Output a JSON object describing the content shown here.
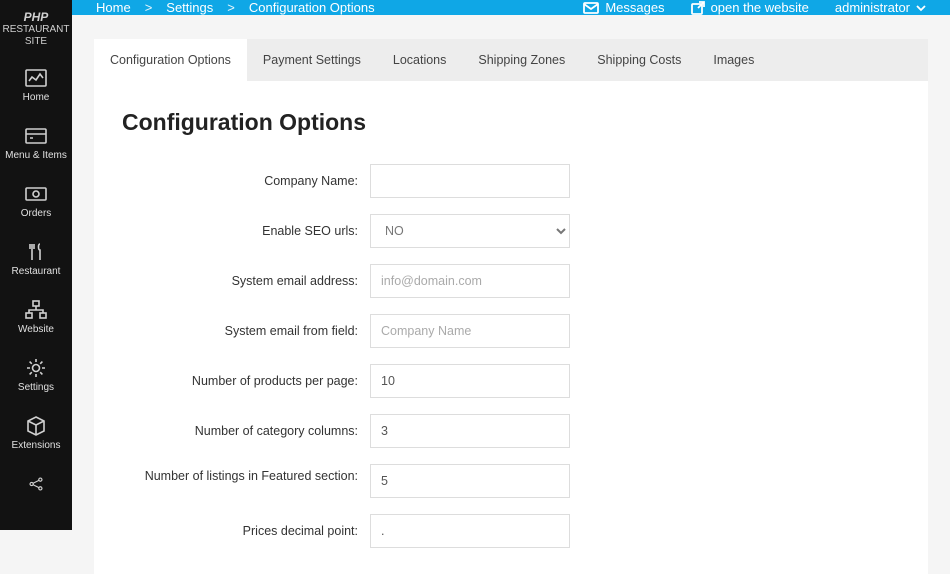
{
  "brand": {
    "line1": "PHP",
    "line2": "RESTAURANT",
    "line3": "SITE"
  },
  "sidebar": {
    "items": [
      {
        "label": "Home"
      },
      {
        "label": "Menu & Items"
      },
      {
        "label": "Orders"
      },
      {
        "label": "Restaurant"
      },
      {
        "label": "Website"
      },
      {
        "label": "Settings"
      },
      {
        "label": "Extensions"
      }
    ]
  },
  "breadcrumb": {
    "home": "Home",
    "settings": "Settings",
    "config": "Configuration Options",
    "sep": ">"
  },
  "topbar": {
    "messages": "Messages",
    "open_site": "open the website",
    "admin": "administrator"
  },
  "tabs": [
    {
      "label": "Configuration Options"
    },
    {
      "label": "Payment Settings"
    },
    {
      "label": "Locations"
    },
    {
      "label": "Shipping Zones"
    },
    {
      "label": "Shipping Costs"
    },
    {
      "label": "Images"
    }
  ],
  "panel": {
    "title": "Configuration Options"
  },
  "form": {
    "company_name": {
      "label": "Company Name:",
      "value": ""
    },
    "seo": {
      "label": "Enable SEO urls:",
      "value": "NO"
    },
    "sys_email": {
      "label": "System email address:",
      "placeholder": "info@domain.com",
      "value": ""
    },
    "email_from": {
      "label": "System email from field:",
      "placeholder": "Company Name",
      "value": ""
    },
    "per_page": {
      "label": "Number of products per page:",
      "value": "10"
    },
    "cat_cols": {
      "label": "Number of category columns:",
      "value": "3"
    },
    "featured": {
      "label": "Number of listings in Featured section:",
      "value": "5"
    },
    "decimal": {
      "label": "Prices decimal point:",
      "value": "."
    }
  }
}
